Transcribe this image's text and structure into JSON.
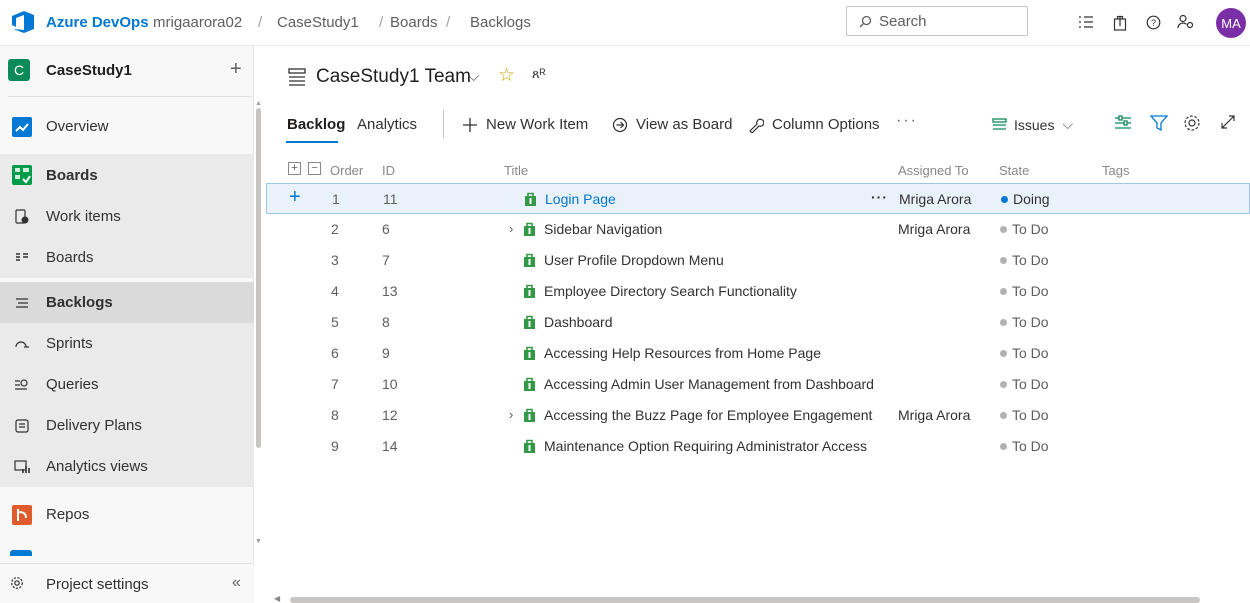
{
  "topbar": {
    "brand": "Azure DevOps",
    "org": "mrigaarora02",
    "breadcrumb": [
      "CaseStudy1",
      "Boards",
      "Backlogs"
    ],
    "search_placeholder": "Search",
    "avatar_initials": "MA"
  },
  "sidebar": {
    "project_initial": "C",
    "project_name": "CaseStudy1",
    "items": [
      {
        "label": "Overview"
      },
      {
        "label": "Boards"
      },
      {
        "label": "Work items"
      },
      {
        "label": "Boards"
      },
      {
        "label": "Backlogs"
      },
      {
        "label": "Sprints"
      },
      {
        "label": "Queries"
      },
      {
        "label": "Delivery Plans"
      },
      {
        "label": "Analytics views"
      },
      {
        "label": "Repos"
      }
    ],
    "settings_label": "Project settings"
  },
  "header": {
    "team_title": "CaseStudy1 Team",
    "tabs": [
      "Backlog",
      "Analytics"
    ],
    "commands": {
      "new_work_item": "New Work Item",
      "view_as_board": "View as Board",
      "column_options": "Column Options",
      "more": "···"
    },
    "issues_label": "Issues"
  },
  "grid": {
    "columns": {
      "order": "Order",
      "id": "ID",
      "title": "Title",
      "assigned_to": "Assigned To",
      "state": "State",
      "tags": "Tags"
    },
    "rows": [
      {
        "order": "1",
        "id": "11",
        "title": "Login Page",
        "assigned_to": "Mriga Arora",
        "state": "Doing",
        "state_color": "#0078d4",
        "selected": true,
        "expandable": false
      },
      {
        "order": "2",
        "id": "6",
        "title": "Sidebar Navigation",
        "assigned_to": "Mriga Arora",
        "state": "To Do",
        "state_color": "#b2b2b2",
        "selected": false,
        "expandable": true
      },
      {
        "order": "3",
        "id": "7",
        "title": "User Profile Dropdown Menu",
        "assigned_to": "",
        "state": "To Do",
        "state_color": "#b2b2b2",
        "selected": false,
        "expandable": false
      },
      {
        "order": "4",
        "id": "13",
        "title": "Employee Directory Search Functionality",
        "assigned_to": "",
        "state": "To Do",
        "state_color": "#b2b2b2",
        "selected": false,
        "expandable": false
      },
      {
        "order": "5",
        "id": "8",
        "title": "Dashboard",
        "assigned_to": "",
        "state": "To Do",
        "state_color": "#b2b2b2",
        "selected": false,
        "expandable": false
      },
      {
        "order": "6",
        "id": "9",
        "title": "Accessing Help Resources from Home Page",
        "assigned_to": "",
        "state": "To Do",
        "state_color": "#b2b2b2",
        "selected": false,
        "expandable": false
      },
      {
        "order": "7",
        "id": "10",
        "title": "Accessing Admin User Management from Dashboard",
        "assigned_to": "",
        "state": "To Do",
        "state_color": "#b2b2b2",
        "selected": false,
        "expandable": false
      },
      {
        "order": "8",
        "id": "12",
        "title": "Accessing the Buzz Page for Employee Engagement",
        "assigned_to": "Mriga Arora",
        "state": "To Do",
        "state_color": "#b2b2b2",
        "selected": false,
        "expandable": true
      },
      {
        "order": "9",
        "id": "14",
        "title": "Maintenance Option Requiring Administrator Access",
        "assigned_to": "",
        "state": "To Do",
        "state_color": "#b2b2b2",
        "selected": false,
        "expandable": false
      }
    ]
  },
  "colors": {
    "accent": "#0078d4",
    "project": "#0d8a5a",
    "avatar": "#7b2fa7",
    "work_item_icon": "#339947"
  }
}
